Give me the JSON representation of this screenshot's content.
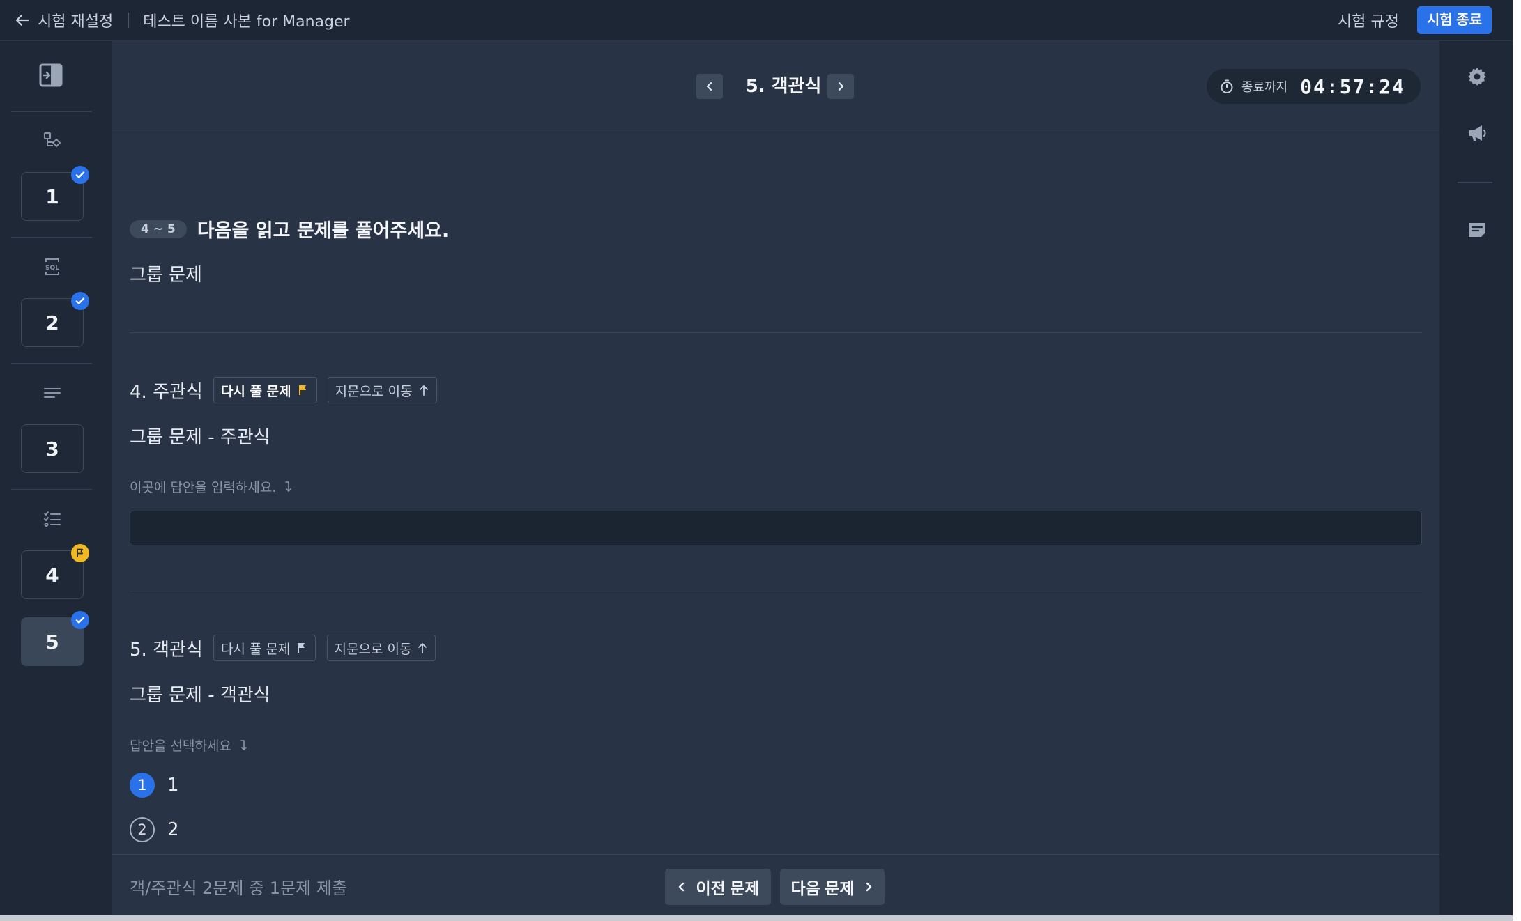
{
  "topbar": {
    "back_label": "시험 재설정",
    "test_name": "테스트 이름 사본 for Manager",
    "rules_label": "시험 규정",
    "end_label": "시험 종료"
  },
  "sidebar": {
    "items": [
      {
        "number": "1",
        "icon": "diagram-icon",
        "status": "answered"
      },
      {
        "number": "2",
        "icon": "sql-icon",
        "status": "answered"
      },
      {
        "number": "3",
        "icon": "text-lines-icon",
        "status": "none"
      },
      {
        "number": "4",
        "icon": "checklist-icon",
        "status": "flagged"
      },
      {
        "number": "5",
        "icon": "checklist-icon",
        "status": "answered",
        "active": true
      }
    ]
  },
  "header": {
    "question_title": "5. 객관식",
    "timer_label": "종료까지",
    "timer_value": "04:57:24"
  },
  "group": {
    "range": "4 ~ 5",
    "instruction": "다음을 읽고 문제를 풀어주세요.",
    "text": "그룹 문제"
  },
  "q4": {
    "label": "4. 주관식",
    "retry_label": "다시 풀 문제",
    "goto_label": "지문으로 이동",
    "text": "그룹 문제 - 주관식",
    "hint": "이곳에 답안을 입력하세요.",
    "answer": ""
  },
  "q5": {
    "label": "5. 객관식",
    "retry_label": "다시 풀 문제",
    "goto_label": "지문으로 이동",
    "text": "그룹 문제 - 객관식",
    "hint": "답안을 선택하세요",
    "choices": [
      {
        "num": "1",
        "label": "1",
        "selected": true
      },
      {
        "num": "2",
        "label": "2",
        "selected": false
      }
    ]
  },
  "footer": {
    "status": "객/주관식 2문제 중 1문제 제출",
    "prev_label": "이전 문제",
    "next_label": "다음 문제"
  },
  "colors": {
    "accent": "#2a72ea",
    "flag": "#f2b824",
    "panel": "#283345",
    "sidebar": "#1f2836"
  }
}
